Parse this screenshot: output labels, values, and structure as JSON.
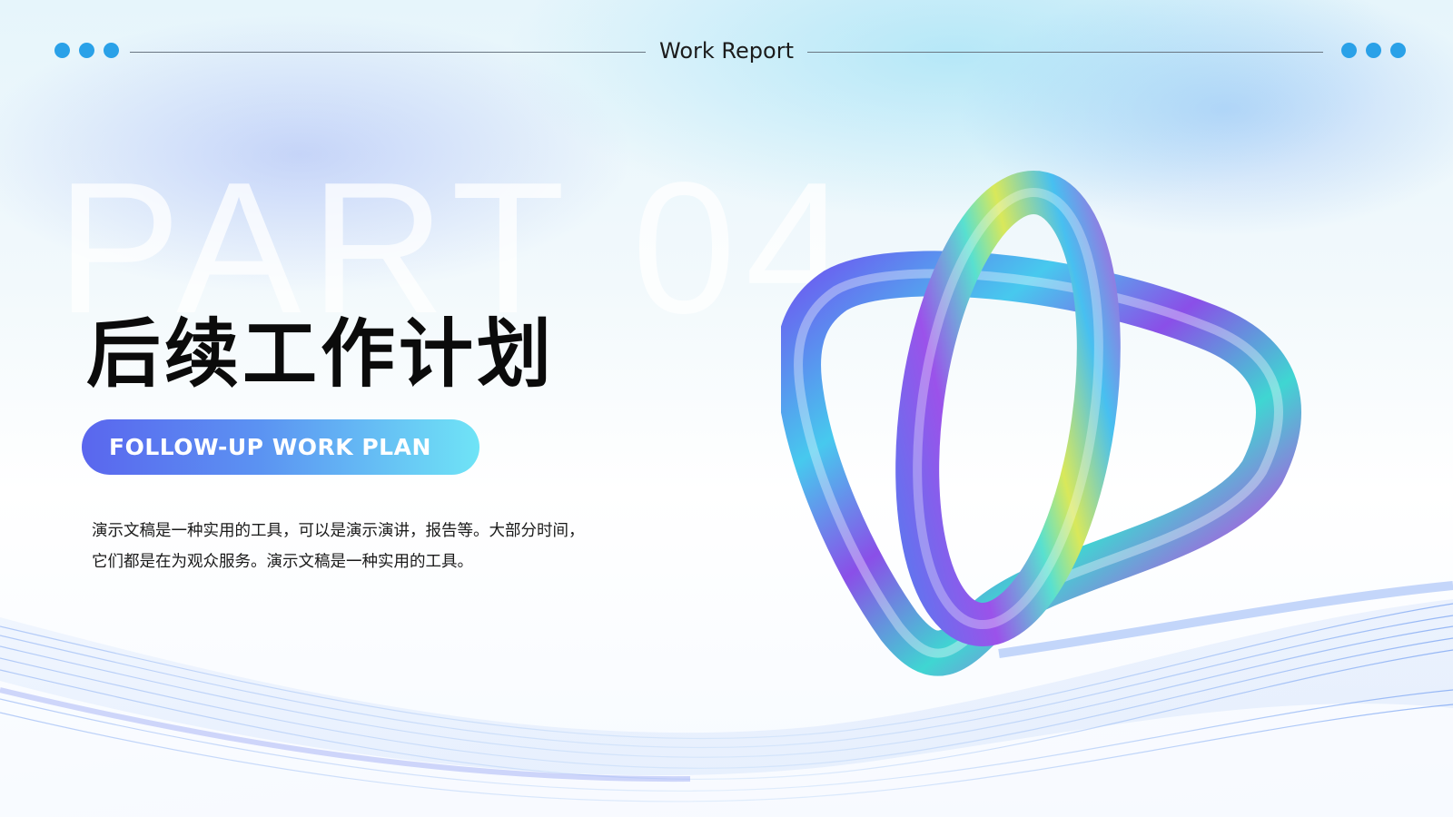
{
  "header": {
    "title": "Work Report"
  },
  "watermark": "PART 04",
  "section": {
    "title": "后续工作计划",
    "subtitle": "FOLLOW-UP WORK PLAN",
    "description_lines": [
      "演示文稿是一种实用的工具，可以是演示演讲，报告等。大部分时间，",
      "它们都是在为观众服务。演示文稿是一种实用的工具。"
    ]
  },
  "colors": {
    "dot": "#2aa1e8",
    "pill_start": "#5a66ee",
    "pill_end": "#6fe4f6",
    "title": "#0b0b0b"
  },
  "icons": {
    "decoration": "iridescent-knot-ring-icon"
  }
}
